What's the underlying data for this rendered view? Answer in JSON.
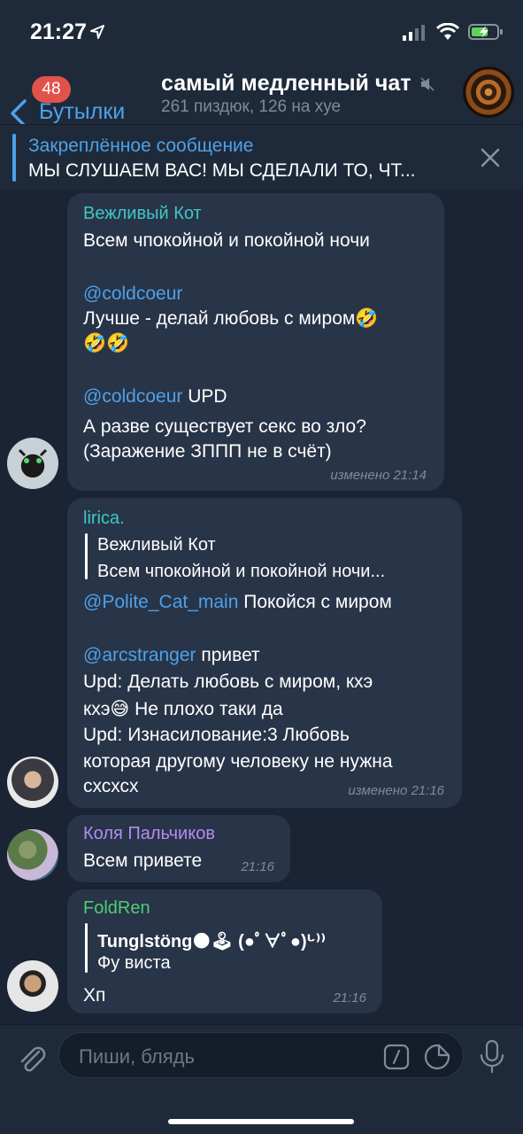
{
  "status": {
    "time": "21:27"
  },
  "header": {
    "back_label": "Бутылки",
    "unread_badge": "48",
    "title": "самый медленный чат",
    "subtitle": "261 пиздюк, 126 на хуе"
  },
  "pinned": {
    "title": "Закреплённое сообщение",
    "text": "МЫ СЛУШАЕМ ВАС!  МЫ СДЕЛАЛИ ТО, ЧТ..."
  },
  "messages": [
    {
      "sender": "Вежливый Кот",
      "sender_color": "#3fc7c5",
      "l1": "Всем чпокойной и покойной ночи",
      "mention1": "@coldcoeur",
      "l2": "Лучше - делай любовь с миром🤣",
      "l3": "🤣🤣",
      "mention2": "@coldcoeur",
      "l4_tail": " UPD",
      "l5": "А разве существует секс во зло?",
      "l6": "(Заражение ЗППП не в счёт)",
      "meta": "изменено 21:14"
    },
    {
      "sender": "lirica.",
      "sender_color": "#3fc7c5",
      "reply_name": "Вежливый Кот",
      "reply_text": "Всем чпокойной и покойной ночи...",
      "mention1": "@Polite_Cat_main",
      "l1_tail": " Покойся с миром",
      "mention2": "@arcstranger",
      "l2_tail": " привет",
      "l3": "Upd: Делать любовь с миром, кхэ",
      "l4": "кхэ😅 Не плохо таки да",
      "l5": "Upd: Изнасилование:3 Любовь",
      "l6": "которая другому человеку не нужна",
      "l7": "схсхсх",
      "meta": "изменено 21:16"
    },
    {
      "sender": "Коля Пальчиков",
      "sender_color": "#b48cf0",
      "l1": "Всем привете",
      "meta": "21:16"
    },
    {
      "sender": "FoldRen",
      "sender_color": "#4fce72",
      "reply_name": "Tunglstöng🌑🕹 (●ﾟ∀ﾟ●)ᒡ⁾⁾",
      "reply_text": "Фу виста",
      "l1": "Хп",
      "meta": "21:16"
    }
  ],
  "composer": {
    "placeholder": "Пиши, блядь"
  },
  "colors": {
    "accent": "#4ea1e8",
    "bubble": "#283448",
    "background": "#1b2434",
    "badge": "#e0534a"
  }
}
